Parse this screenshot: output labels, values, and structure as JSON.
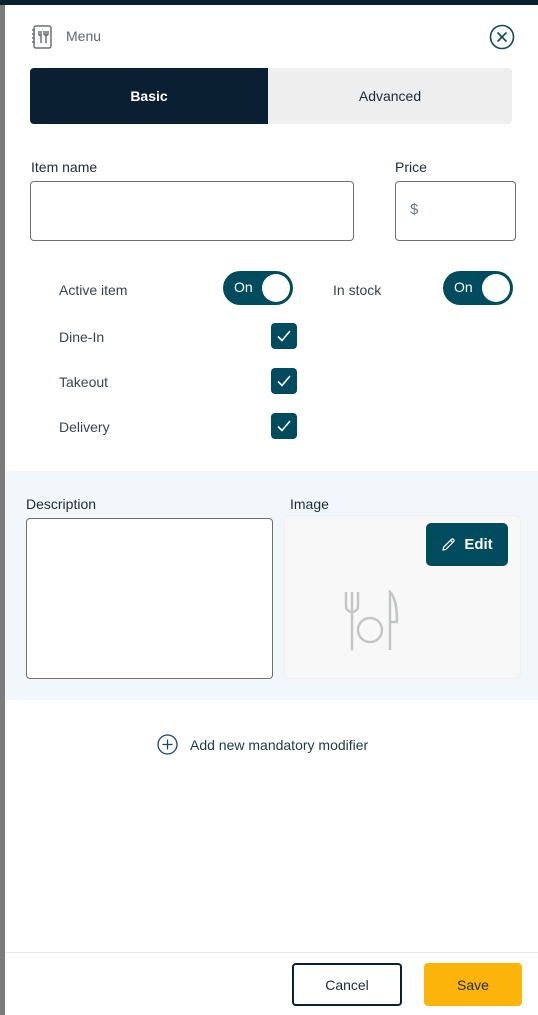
{
  "header": {
    "title": "Menu",
    "menu_icon": "menu-book-icon",
    "close_icon": "close-circle-icon"
  },
  "tabs": [
    {
      "label": "Basic",
      "active": true
    },
    {
      "label": "Advanced",
      "active": false
    }
  ],
  "form": {
    "item_name": {
      "label": "Item name",
      "value": "",
      "placeholder": ""
    },
    "price": {
      "label": "Price",
      "prefix": "$",
      "value": ""
    }
  },
  "toggles": [
    {
      "label": "Active item",
      "state_label": "On",
      "on": true
    },
    {
      "label": "In stock",
      "state_label": "On",
      "on": true
    }
  ],
  "checkboxes": [
    {
      "label": "Dine-In",
      "checked": true
    },
    {
      "label": "Takeout",
      "checked": true
    },
    {
      "label": "Delivery",
      "checked": true
    }
  ],
  "media": {
    "description_label": "Description",
    "description_value": "",
    "image_label": "Image",
    "edit_label": "Edit",
    "placeholder_icon": "cutlery-plate-icon"
  },
  "add_modifier_label": "Add new mandatory modifier",
  "footer": {
    "cancel_label": "Cancel",
    "save_label": "Save"
  },
  "colors": {
    "primary_dark": "#0b1f33",
    "accent_teal": "#004c5e",
    "save_yellow": "#fcb40a",
    "section_bg": "#f1f7fa"
  }
}
